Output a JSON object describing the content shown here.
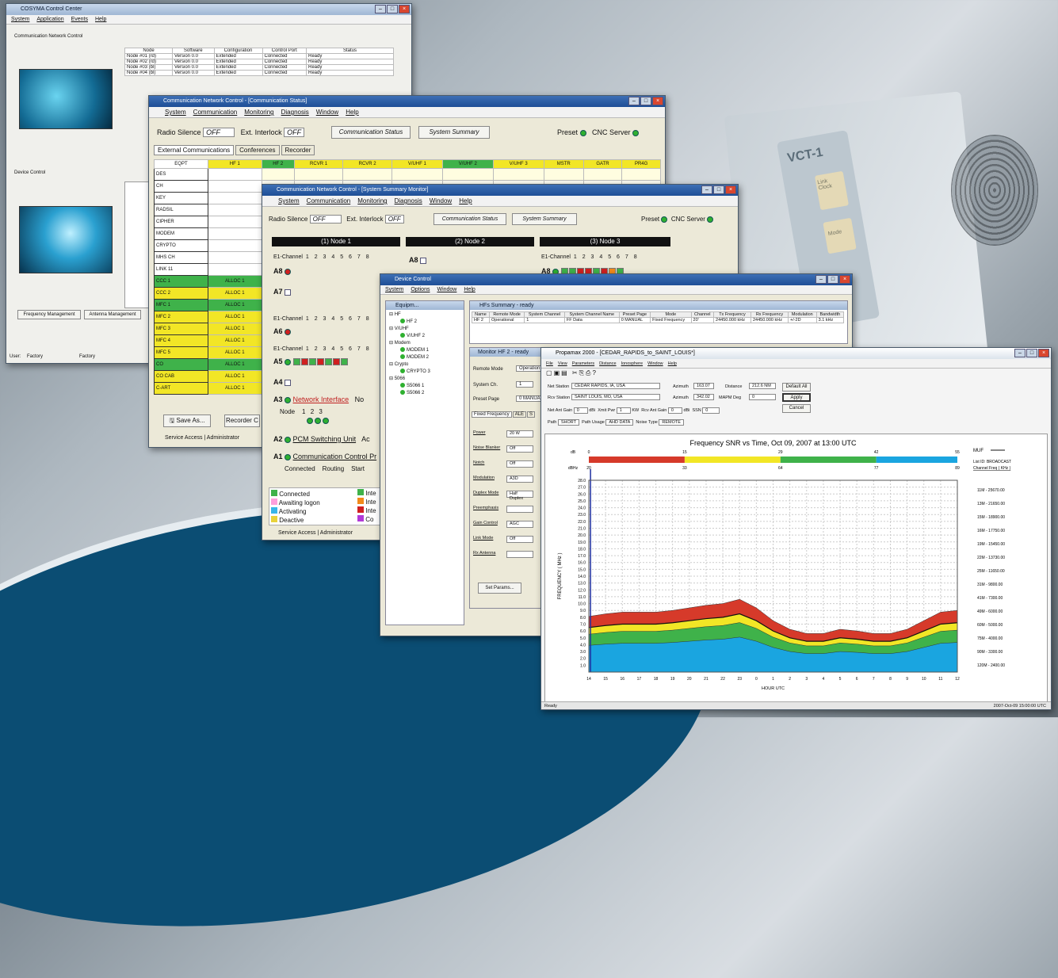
{
  "bg": {
    "vct": "VCT-1",
    "btn1": "Link Clock",
    "btn2": "Mode"
  },
  "w1": {
    "title": "COSYMA Control Center",
    "menu": [
      "System",
      "Application",
      "Events",
      "Help"
    ],
    "section1": "Communication Network Control",
    "section2": "Device Control",
    "cols": [
      "Node",
      "Software",
      "Configuration",
      "Control Port",
      "Status"
    ],
    "rows": [
      [
        "Node #01 (rd)",
        "Version 0.0",
        "Extended",
        "Connected",
        "Ready"
      ],
      [
        "Node #02 (rd)",
        "Version 0.0",
        "Extended",
        "Connected",
        "Ready"
      ],
      [
        "Node #03 (bl)",
        "Version 0.0",
        "Extended",
        "Connected",
        "Ready"
      ],
      [
        "Node #04 (bl)",
        "Version 0.0",
        "Extended",
        "Connected",
        "Ready"
      ]
    ],
    "freq_btn": "Frequency Management",
    "ant_btn": "Antenna Management",
    "user_label": "User:",
    "user_value": "Factory",
    "user_value2": "Factory"
  },
  "w2": {
    "title": "Communication Network Control - [Communication Status]",
    "menu": [
      "System",
      "Communication",
      "Monitoring",
      "Diagnosis",
      "Window",
      "Help"
    ],
    "radio_silence": "Radio Silence",
    "off": "OFF",
    "ext_interlock": "Ext. Interlock",
    "comm_status": "Communication Status",
    "sys_summary": "System Summary",
    "preset": "Preset",
    "cnc": "CNC Server",
    "tabs": [
      "External Communications",
      "Conferences",
      "Recorder"
    ],
    "cols": [
      "EQPT",
      "HF 1",
      "HF 2",
      "RCVR 1",
      "RCVR 2",
      "V/UHF 1",
      "V/UHF 2",
      "V/UHF 3",
      "MSTR",
      "GATR",
      "PR4G"
    ],
    "rows": [
      [
        "DES",
        ""
      ],
      [
        "CH",
        ""
      ],
      [
        "KEY",
        ""
      ],
      [
        "RADSIL",
        ""
      ],
      [
        "CIPHER",
        ""
      ],
      [
        "MODEM",
        ""
      ],
      [
        "CRYPTO",
        ""
      ],
      [
        "MHS CH",
        ""
      ],
      [
        "LINK 11",
        ""
      ],
      [
        "CCC 1",
        "ALLOC 1"
      ],
      [
        "CCC 2",
        "ALLOC 1"
      ],
      [
        "MFC 1",
        "ALLOC 1"
      ],
      [
        "MFC 2",
        "ALLOC 1"
      ],
      [
        "MFC 3",
        "ALLOC 1"
      ],
      [
        "MFC 4",
        "ALLOC 1"
      ],
      [
        "MFC 5",
        "ALLOC 1"
      ],
      [
        "CO",
        "ALLOC 1"
      ],
      [
        "CO CAB",
        "ALLOC 1"
      ],
      [
        "C-ART",
        "ALLOC 1"
      ]
    ],
    "save_as": "Save As...",
    "recorder": "Recorder C",
    "service": "Service Access",
    "admin": "Administrator"
  },
  "w3": {
    "title": "Communication Network Control - [System Summary Monitor]",
    "menu": [
      "System",
      "Communication",
      "Monitoring",
      "Diagnosis",
      "Window",
      "Help"
    ],
    "radio_silence": "Radio Silence",
    "off": "OFF",
    "ext_interlock": "Ext. Interlock",
    "comm_status": "Communication Status",
    "sys_summary": "System Summary",
    "preset": "Preset",
    "cnc": "CNC Server",
    "node1": "(1) Node 1",
    "node2": "(2) Node 2",
    "node3": "(3) Node 3",
    "e1": "E1-Channel",
    "nums": "1 2 3 4 5 6 7 8",
    "a8": "A8",
    "a7": "A7",
    "a6": "A6",
    "a5": "A5",
    "a4": "A4",
    "a3": "A3",
    "a2": "A2",
    "a1": "A1",
    "network_interface": "Network Interface",
    "no": "No",
    "node_label": "Node",
    "node_nums": "1 2 3",
    "pcm": "PCM Switching Unit",
    "ac": "Ac",
    "ccp": "Communication Control Pr",
    "connected": "Connected",
    "routing": "Routing",
    "start": "Start",
    "legend": [
      "Connected",
      "Awaiting logon",
      "Activating",
      "Deactive"
    ],
    "legend2": [
      "Inte",
      "Inte",
      "Inte",
      "Co"
    ],
    "service": "Service Access",
    "admin": "Administrator"
  },
  "w4": {
    "title": "Device Control",
    "menu": [
      "System",
      "Options",
      "Window",
      "Help"
    ],
    "equip": "Equipm...",
    "hfs": "HFs Summary - ready",
    "tree": [
      "HF",
      "HF 2",
      "V/UHF",
      "V/UHF 2",
      "Modem",
      "MODEM 1",
      "MODEM 2",
      "Crypto",
      "CRYPTO 3",
      "5066",
      "S5066 1",
      "S5066 2"
    ],
    "cols": [
      "Name",
      "Remote Mode",
      "System Channel",
      "System Channel Name",
      "Preset Page",
      "Mode",
      "Channel",
      "Tx Frequency",
      "Rx Frequency",
      "Modulation",
      "Bandwidth"
    ],
    "row": [
      "HF 2",
      "Operational",
      "1",
      "",
      "0 MANUAL",
      "Fixed Frequency",
      "20'",
      "24450.000 kHz",
      "24450.000 kHz",
      "+/-2D",
      "3.1 kHz"
    ],
    "ff_data": "FF Data",
    "monitor": "Monitor HF 2 - ready",
    "remote_mode": "Remote Mode",
    "remote_val": "Operation",
    "system_ch": "System Ch.",
    "system_ch_val": "1",
    "preset_page": "Preset Page",
    "preset_val": "0 MANUAL",
    "tabs": [
      "Fixed Frequency",
      "ALE",
      "S"
    ],
    "fields": [
      [
        "Power",
        "20 W"
      ],
      [
        "Noise Blanker",
        "Off"
      ],
      [
        "Notch",
        "Off"
      ],
      [
        "Modulation",
        "A3D"
      ],
      [
        "Duplex Mode",
        "Half Duplex"
      ],
      [
        "Preemphasis",
        ""
      ],
      [
        "Gain Control",
        "AGC"
      ],
      [
        "Link Mode",
        "Off"
      ],
      [
        "Rx Antenna",
        ""
      ]
    ],
    "set_params": "Set Params..."
  },
  "w5": {
    "title": "Propamax 2000 - [CEDAR_RAPIDS_to_SAINT_LOUIS*]",
    "menu": [
      "File",
      "View",
      "Parameters",
      "Distance",
      "Ionosphere",
      "Window",
      "Help"
    ],
    "net_station": "Net Station",
    "net_val": "CEDAR RAPIDS, IA, USA",
    "rcv_station": "Rcv Station",
    "rcv_val": "SAINT LOUIS, MO, USA",
    "azimuth": "Azimuth",
    "az1": "163.07",
    "az2": "342.02",
    "distance": "Distance",
    "dist_val": "212.6 NM",
    "mapm": "MAPM Deg",
    "mapm_val": "0",
    "default_all": "Default All",
    "apply": "Apply",
    "cancel": "Cancel",
    "net_ant": "Net Ant Gain",
    "net_ant_val": "0",
    "db": "dBi",
    "xmit": "Xmit Pwr",
    "xmit_val": "1",
    "kw": "KW",
    "rcv_ant": "Rcv Ant Gain",
    "rcv_ant_val": "0",
    "ssn": "SSN",
    "ssn_val": "0",
    "path": "Path",
    "path_val": "SHORT",
    "path_usage": "Path Usage",
    "path_usage_val": "AHD DATA",
    "noise_type": "Noise Type",
    "noise_val": "REMOTE",
    "status": "Ready",
    "status_right": "2007-Oct-09 15:00:00 UTC"
  },
  "chart_data": {
    "type": "area",
    "title": "Frequency SNR vs Time, Oct 09, 2007  at  13:00 UTC",
    "xlabel": "HOUR UTC",
    "ylabel": "FREQUENCY ( MHz )",
    "x": [
      14,
      15,
      16,
      17,
      18,
      19,
      20,
      21,
      22,
      23,
      0,
      1,
      2,
      3,
      4,
      5,
      6,
      7,
      8,
      9,
      10,
      11,
      12
    ],
    "yticks": [
      1.0,
      2.0,
      3.0,
      4.0,
      5.0,
      6.0,
      7.0,
      8.0,
      9.0,
      10.0,
      11.0,
      12.0,
      13.0,
      14.0,
      15.0,
      16.0,
      17.0,
      18.0,
      19.0,
      20.0,
      21.0,
      22.0,
      23.0,
      24.0,
      25.0,
      26.0,
      27.0,
      28.0
    ],
    "ylim": [
      0,
      28
    ],
    "db_scale": [
      "dB",
      "0",
      "15",
      "29",
      "42",
      "55"
    ],
    "dbhz_scale": [
      "dBHz",
      "20",
      "33",
      "64",
      "77",
      "89"
    ],
    "series": [
      {
        "values": [
          6.5,
          6.8,
          7.0,
          7.0,
          7.0,
          7.2,
          7.5,
          7.8,
          8.0,
          8.5,
          7.5,
          6.0,
          5.0,
          4.5,
          4.5,
          5.0,
          4.8,
          4.5,
          4.5,
          5.0,
          6.0,
          7.0,
          7.2
        ]
      }
    ],
    "mode_colors": [
      "#d63a2a",
      "#f2e626",
      "#3fb24a",
      "#1aa5e0"
    ],
    "right_label": "MUF",
    "right_sub": "List ID: BROADCAST",
    "right_cols": "Channel   Freq ( KHz )",
    "channels": [
      "11M - 25670.00",
      "13M - 21650.00",
      "15M - 18900.00",
      "16M - 17750.00",
      "19M - 15450.00",
      "22M - 13730.00",
      "25M - 11650.00",
      "31M - 9800.00",
      "41M - 7300.00",
      "49M - 6000.00",
      "60M - 5000.00",
      "75M - 4000.00",
      "90M - 3300.00",
      "120M - 2400.00"
    ]
  }
}
